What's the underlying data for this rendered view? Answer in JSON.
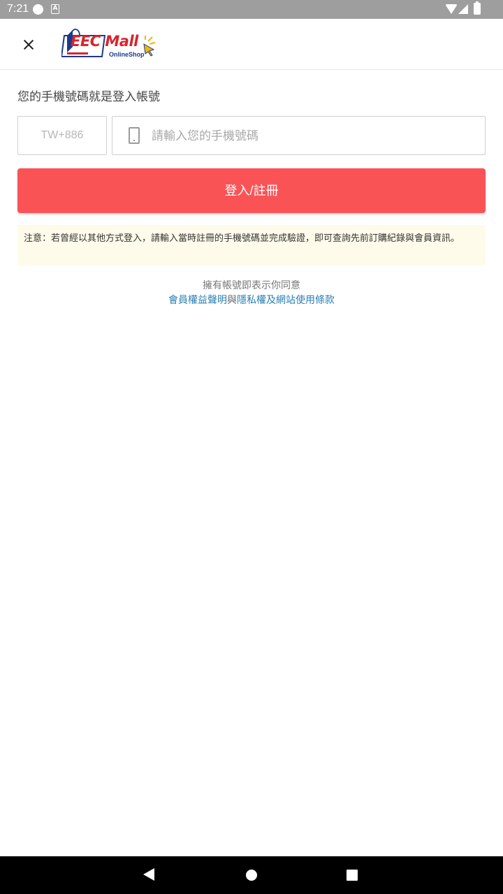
{
  "status_bar": {
    "time": "7:21",
    "icons": [
      "notification-dot-icon",
      "a-icon",
      "wifi-icon",
      "signal-icon",
      "battery-icon"
    ]
  },
  "header": {
    "close_icon": "close-icon",
    "logo_text": "EEC Mall",
    "logo_subtext": "OnlineShop"
  },
  "login": {
    "hint": "您的手機號碼就是登入帳號",
    "country_code": "TW+886",
    "phone_placeholder": "請輸入您的手機號碼",
    "phone_value": "",
    "phone_icon": "phone-icon",
    "submit_label": "登入/註冊",
    "notice": "注意：若曾經以其他方式登入，請輸入當時註冊的手機號碼並完成驗證，即可查詢先前訂購紀錄與會員資訊。"
  },
  "agreement": {
    "text": "擁有帳號即表示你同意",
    "link_member": "會員權益聲明",
    "conjunction": "與",
    "link_privacy": "隱私權及網站使用條款"
  },
  "colors": {
    "accent": "#fa5356",
    "link": "#2a7fb5",
    "notice_bg": "#fffbea",
    "logo_red": "#d7252c",
    "logo_blue": "#1b3a8c"
  }
}
